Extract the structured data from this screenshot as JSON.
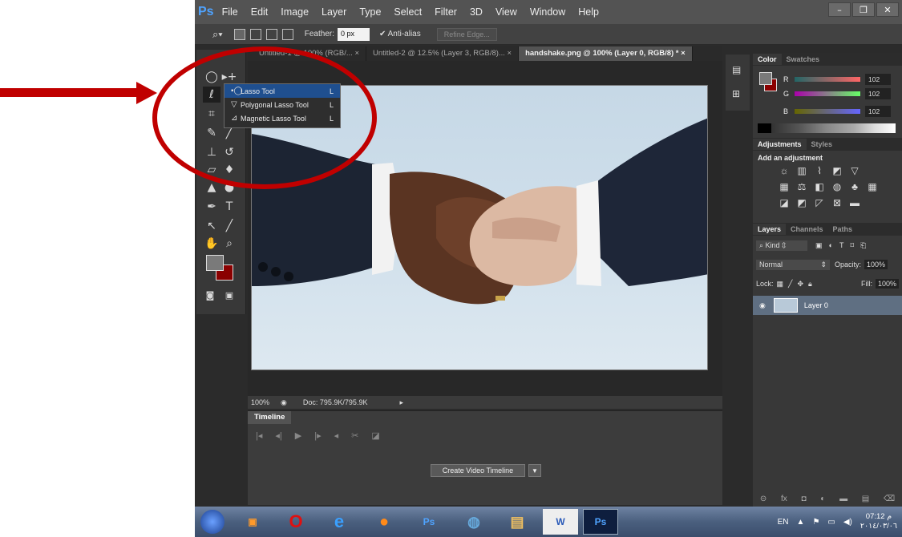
{
  "app": {
    "logo": "Ps",
    "menus": [
      "File",
      "Edit",
      "Image",
      "Layer",
      "Type",
      "Select",
      "Filter",
      "3D",
      "View",
      "Window",
      "Help"
    ],
    "window_controls": [
      "–",
      "❐",
      "✕"
    ]
  },
  "options_bar": {
    "feather_label": "Feather:",
    "feather_value": "0 px",
    "antialias_label": "Anti-alias",
    "refine_edge_label": "Refine Edge..."
  },
  "doc_tabs": [
    {
      "label": "Untitled-1 @ 100% (RGB/...",
      "active": false
    },
    {
      "label": "Untitled-2 @ 12.5% (Layer 3, RGB/8)...",
      "active": false
    },
    {
      "label": "handshake.png @ 100% (Layer 0, RGB/8) *",
      "active": true
    }
  ],
  "flyout": {
    "items": [
      {
        "label": "Lasso Tool",
        "key": "L",
        "selected": true
      },
      {
        "label": "Polygonal Lasso Tool",
        "key": "L",
        "selected": false
      },
      {
        "label": "Magnetic Lasso Tool",
        "key": "L",
        "selected": false
      }
    ]
  },
  "status": {
    "zoom": "100%",
    "doc": "Doc: 795.9K/795.9K"
  },
  "timeline": {
    "tab_label": "Timeline",
    "create_button": "Create Video Timeline"
  },
  "color_panel": {
    "tabs": [
      "Color",
      "Swatches"
    ],
    "channels": [
      {
        "letter": "R",
        "value": "102"
      },
      {
        "letter": "G",
        "value": "102"
      },
      {
        "letter": "B",
        "value": "102"
      }
    ]
  },
  "adjustments_panel": {
    "tabs": [
      "Adjustments",
      "Styles"
    ],
    "heading": "Add an adjustment"
  },
  "layers_panel": {
    "tabs": [
      "Layers",
      "Channels",
      "Paths"
    ],
    "kind_label": "Kind",
    "blend_mode": "Normal",
    "opacity_label": "Opacity:",
    "opacity_value": "100%",
    "lock_label": "Lock:",
    "fill_label": "Fill:",
    "fill_value": "100%",
    "layers": [
      {
        "name": "Layer 0",
        "visible": true
      }
    ]
  },
  "taskbar": {
    "tray_lang": "EN",
    "clock_time": "07:12 م",
    "clock_date": "٢٠١٤/٠٣/٠٦"
  },
  "colors": {
    "annotation_red": "#c00000",
    "foreground_swatch": "#7a7a7a",
    "background_swatch": "#8a0000",
    "ps_blue": "#4fa3ff"
  }
}
